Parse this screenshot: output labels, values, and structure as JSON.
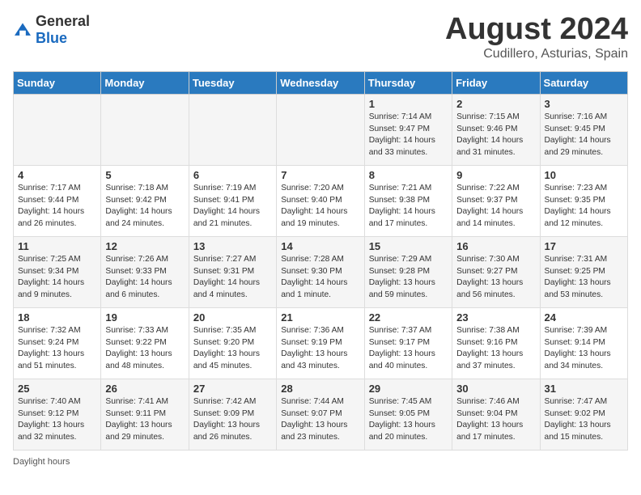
{
  "header": {
    "logo_general": "General",
    "logo_blue": "Blue",
    "main_title": "August 2024",
    "subtitle": "Cudillero, Asturias, Spain"
  },
  "days_of_week": [
    "Sunday",
    "Monday",
    "Tuesday",
    "Wednesday",
    "Thursday",
    "Friday",
    "Saturday"
  ],
  "weeks": [
    [
      {
        "day": "",
        "info": ""
      },
      {
        "day": "",
        "info": ""
      },
      {
        "day": "",
        "info": ""
      },
      {
        "day": "",
        "info": ""
      },
      {
        "day": "1",
        "info": "Sunrise: 7:14 AM\nSunset: 9:47 PM\nDaylight: 14 hours\nand 33 minutes."
      },
      {
        "day": "2",
        "info": "Sunrise: 7:15 AM\nSunset: 9:46 PM\nDaylight: 14 hours\nand 31 minutes."
      },
      {
        "day": "3",
        "info": "Sunrise: 7:16 AM\nSunset: 9:45 PM\nDaylight: 14 hours\nand 29 minutes."
      }
    ],
    [
      {
        "day": "4",
        "info": "Sunrise: 7:17 AM\nSunset: 9:44 PM\nDaylight: 14 hours\nand 26 minutes."
      },
      {
        "day": "5",
        "info": "Sunrise: 7:18 AM\nSunset: 9:42 PM\nDaylight: 14 hours\nand 24 minutes."
      },
      {
        "day": "6",
        "info": "Sunrise: 7:19 AM\nSunset: 9:41 PM\nDaylight: 14 hours\nand 21 minutes."
      },
      {
        "day": "7",
        "info": "Sunrise: 7:20 AM\nSunset: 9:40 PM\nDaylight: 14 hours\nand 19 minutes."
      },
      {
        "day": "8",
        "info": "Sunrise: 7:21 AM\nSunset: 9:38 PM\nDaylight: 14 hours\nand 17 minutes."
      },
      {
        "day": "9",
        "info": "Sunrise: 7:22 AM\nSunset: 9:37 PM\nDaylight: 14 hours\nand 14 minutes."
      },
      {
        "day": "10",
        "info": "Sunrise: 7:23 AM\nSunset: 9:35 PM\nDaylight: 14 hours\nand 12 minutes."
      }
    ],
    [
      {
        "day": "11",
        "info": "Sunrise: 7:25 AM\nSunset: 9:34 PM\nDaylight: 14 hours\nand 9 minutes."
      },
      {
        "day": "12",
        "info": "Sunrise: 7:26 AM\nSunset: 9:33 PM\nDaylight: 14 hours\nand 6 minutes."
      },
      {
        "day": "13",
        "info": "Sunrise: 7:27 AM\nSunset: 9:31 PM\nDaylight: 14 hours\nand 4 minutes."
      },
      {
        "day": "14",
        "info": "Sunrise: 7:28 AM\nSunset: 9:30 PM\nDaylight: 14 hours\nand 1 minute."
      },
      {
        "day": "15",
        "info": "Sunrise: 7:29 AM\nSunset: 9:28 PM\nDaylight: 13 hours\nand 59 minutes."
      },
      {
        "day": "16",
        "info": "Sunrise: 7:30 AM\nSunset: 9:27 PM\nDaylight: 13 hours\nand 56 minutes."
      },
      {
        "day": "17",
        "info": "Sunrise: 7:31 AM\nSunset: 9:25 PM\nDaylight: 13 hours\nand 53 minutes."
      }
    ],
    [
      {
        "day": "18",
        "info": "Sunrise: 7:32 AM\nSunset: 9:24 PM\nDaylight: 13 hours\nand 51 minutes."
      },
      {
        "day": "19",
        "info": "Sunrise: 7:33 AM\nSunset: 9:22 PM\nDaylight: 13 hours\nand 48 minutes."
      },
      {
        "day": "20",
        "info": "Sunrise: 7:35 AM\nSunset: 9:20 PM\nDaylight: 13 hours\nand 45 minutes."
      },
      {
        "day": "21",
        "info": "Sunrise: 7:36 AM\nSunset: 9:19 PM\nDaylight: 13 hours\nand 43 minutes."
      },
      {
        "day": "22",
        "info": "Sunrise: 7:37 AM\nSunset: 9:17 PM\nDaylight: 13 hours\nand 40 minutes."
      },
      {
        "day": "23",
        "info": "Sunrise: 7:38 AM\nSunset: 9:16 PM\nDaylight: 13 hours\nand 37 minutes."
      },
      {
        "day": "24",
        "info": "Sunrise: 7:39 AM\nSunset: 9:14 PM\nDaylight: 13 hours\nand 34 minutes."
      }
    ],
    [
      {
        "day": "25",
        "info": "Sunrise: 7:40 AM\nSunset: 9:12 PM\nDaylight: 13 hours\nand 32 minutes."
      },
      {
        "day": "26",
        "info": "Sunrise: 7:41 AM\nSunset: 9:11 PM\nDaylight: 13 hours\nand 29 minutes."
      },
      {
        "day": "27",
        "info": "Sunrise: 7:42 AM\nSunset: 9:09 PM\nDaylight: 13 hours\nand 26 minutes."
      },
      {
        "day": "28",
        "info": "Sunrise: 7:44 AM\nSunset: 9:07 PM\nDaylight: 13 hours\nand 23 minutes."
      },
      {
        "day": "29",
        "info": "Sunrise: 7:45 AM\nSunset: 9:05 PM\nDaylight: 13 hours\nand 20 minutes."
      },
      {
        "day": "30",
        "info": "Sunrise: 7:46 AM\nSunset: 9:04 PM\nDaylight: 13 hours\nand 17 minutes."
      },
      {
        "day": "31",
        "info": "Sunrise: 7:47 AM\nSunset: 9:02 PM\nDaylight: 13 hours\nand 15 minutes."
      }
    ]
  ],
  "footer": {
    "daylight_label": "Daylight hours"
  }
}
